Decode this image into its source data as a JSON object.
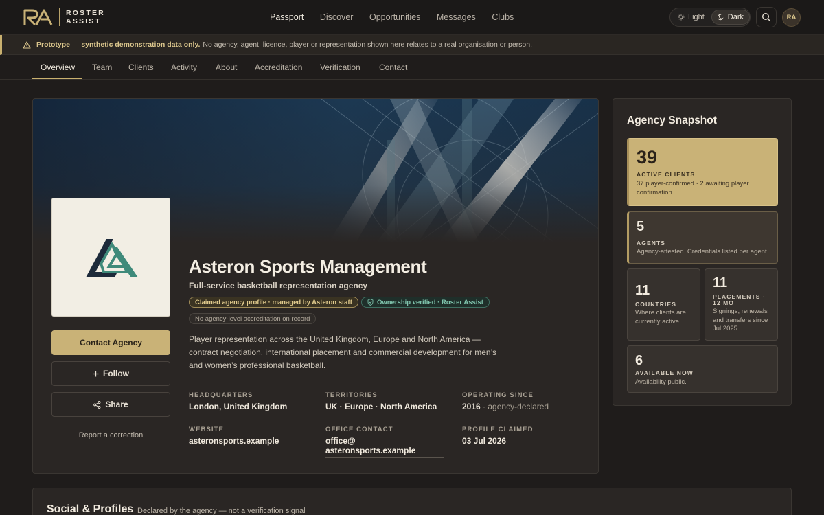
{
  "brand": {
    "line1": "ROSTER",
    "line2": "ASSIST"
  },
  "main_nav": [
    "Passport",
    "Discover",
    "Opportunities",
    "Messages",
    "Clubs"
  ],
  "theme": {
    "light_label": "Light",
    "dark_label": "Dark",
    "selected": "Dark"
  },
  "user": {
    "initials": "RA"
  },
  "banner": {
    "strong": "Prototype — synthetic demonstration data only.",
    "text": "No agency, agent, licence, player or representation shown here relates to a real organisation or person."
  },
  "tabs": [
    "Overview",
    "Team",
    "Clients",
    "Activity",
    "About",
    "Accreditation",
    "Verification",
    "Contact"
  ],
  "profile": {
    "name": "Asteron Sports Management",
    "tagline": "Full-service basketball representation agency",
    "badge_claimed": "Claimed agency profile · managed by Asteron staff",
    "badge_verified": "Ownership verified · Roster Assist",
    "badge_accreditation": "No agency-level accreditation on record",
    "description": "Player representation across the United Kingdom, Europe and North America — contract negotiation, international placement and commercial development for men’s and women’s professional basketball.",
    "contact_label": "Contact Agency",
    "follow_label": "Follow",
    "share_label": "Share",
    "correction_label": "Report a correction",
    "fields": {
      "hq_label": "HEADQUARTERS",
      "hq_value": "London, United Kingdom",
      "territories_label": "TERRITORIES",
      "territories_value": "UK · Europe · North America",
      "since_label": "OPERATING SINCE",
      "since_value": "2016",
      "since_note": "· agency-declared",
      "website_label": "WEBSITE",
      "website_value": "asteronsports.example",
      "office_label": "OFFICE CONTACT",
      "office_value_1": "office@",
      "office_value_2": "asteronsports.example",
      "claimed_label": "PROFILE CLAIMED",
      "claimed_value": "03 Jul 2026"
    }
  },
  "snapshot": {
    "title": "Agency Snapshot",
    "active_clients": {
      "value": "39",
      "label": "ACTIVE CLIENTS",
      "sub": "37 player-confirmed · 2 awaiting player confirmation."
    },
    "agents": {
      "value": "5",
      "label": "AGENTS",
      "sub": "Agency-attested. Credentials listed per agent."
    },
    "countries": {
      "value": "11",
      "label": "COUNTRIES",
      "sub": "Where clients are currently active."
    },
    "placements": {
      "value": "11",
      "label": "PLACEMENTS · 12 MO",
      "sub": "Signings, renewals and transfers since Jul 2025."
    },
    "available": {
      "value": "6",
      "label": "AVAILABLE NOW",
      "sub": "Availability public."
    }
  },
  "social": {
    "title": "Social & Profiles",
    "sub": "Declared by the agency — not a verification signal"
  },
  "colors": {
    "accent_gold": "#c9b277",
    "verified_green": "#7fc4ad",
    "background": "#1f1c1b"
  }
}
